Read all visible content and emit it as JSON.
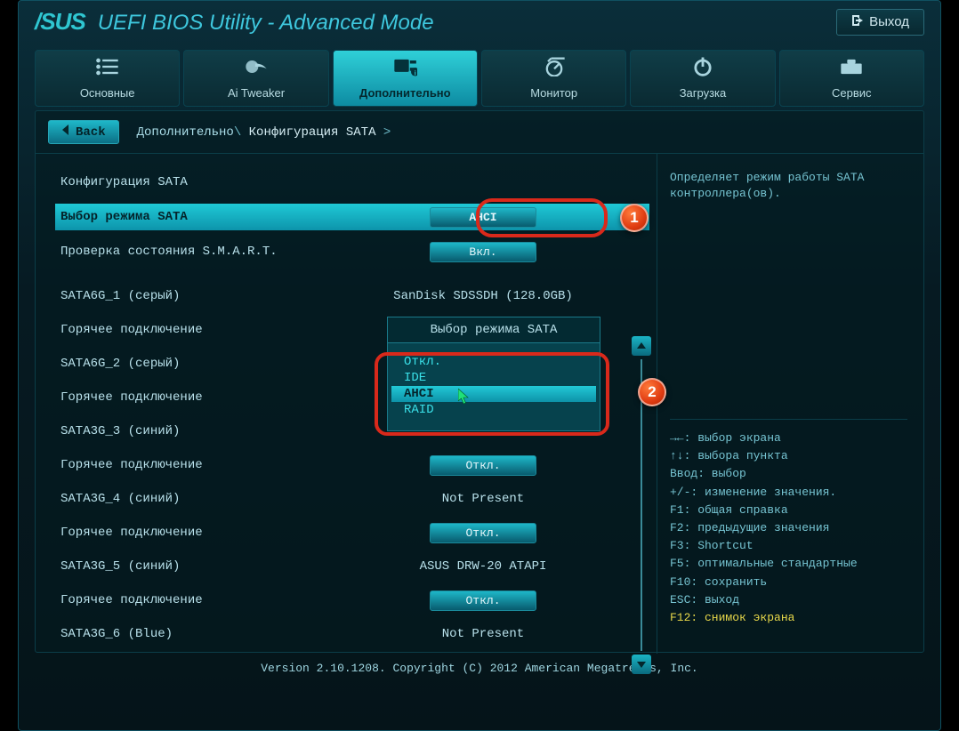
{
  "brand": {
    "logo": "/SUS",
    "title": "UEFI BIOS Utility - Advanced Mode"
  },
  "exit_label": "Выход",
  "tabs": [
    {
      "label": "Основные"
    },
    {
      "label": "Ai Tweaker"
    },
    {
      "label": "Дополнительно"
    },
    {
      "label": "Монитор"
    },
    {
      "label": "Загрузка"
    },
    {
      "label": "Сервис"
    }
  ],
  "back_label": "Back",
  "breadcrumb": {
    "a": "Дополнительно",
    "b": "Конфигурация SATA",
    "sep": "\\",
    "arrow": ">"
  },
  "section_title": "Конфигурация SATA",
  "rows": {
    "sata_mode": {
      "label": "Выбор режима SATA",
      "value": "AHCI"
    },
    "smart": {
      "label": "Проверка состояния S.M.A.R.T.",
      "value": "Вкл."
    },
    "p0": {
      "label": "SATA6G_1 (серый)",
      "value": "SanDisk SDSSDH (128.0GB)"
    },
    "hp0": {
      "label": "Горячее подключение"
    },
    "p1": {
      "label": "SATA6G_2 (серый)"
    },
    "hp1": {
      "label": "Горячее подключение"
    },
    "p2": {
      "label": "SATA3G_3 (синий)"
    },
    "hp2": {
      "label": "Горячее подключение",
      "value": "Откл."
    },
    "p3": {
      "label": "SATA3G_4 (синий)",
      "value": "Not Present"
    },
    "hp3": {
      "label": "Горячее подключение",
      "value": "Откл."
    },
    "p4": {
      "label": "SATA3G_5 (синий)",
      "value": "ASUS    DRW-20 ATAPI"
    },
    "hp4": {
      "label": "Горячее подключение",
      "value": "Откл."
    },
    "p5": {
      "label": "SATA3G_6 (Blue)",
      "value": "Not Present"
    }
  },
  "dropdown": {
    "title": "Выбор режима SATA",
    "items": [
      "Откл.",
      "IDE",
      "AHCI",
      "RAID"
    ]
  },
  "badges": {
    "n1": "1",
    "n2": "2"
  },
  "help": {
    "desc": "Определяет режим работы SATA контроллера(ов).",
    "hints": [
      "→←: выбор экрана",
      "↑↓: выбора пункта",
      "Ввод: выбор",
      "+/-: изменение значения.",
      "F1: общая справка",
      "F2: предыдущие значения",
      "F3: Shortcut",
      "F5: оптимальные стандартные",
      "F10: сохранить",
      "ESC: выход"
    ],
    "f12": "F12: снимок экрана"
  },
  "footer": "Version 2.10.1208. Copyright (C) 2012 American Megatrends, Inc."
}
